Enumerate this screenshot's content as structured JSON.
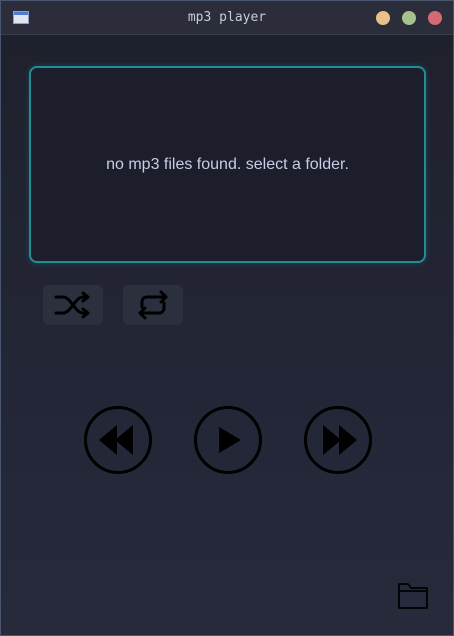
{
  "window": {
    "title": "mp3 player",
    "icon": "app-window-icon",
    "controls": [
      "minimize-button",
      "maximize-button",
      "close-button"
    ],
    "colors": {
      "minimize": "#e7c189",
      "maximize": "#a6c08e",
      "close": "#d46a73"
    }
  },
  "display": {
    "message": "no mp3 files found. select a folder.",
    "accent": "#1f8f95"
  },
  "toggles": [
    {
      "name": "shuffle",
      "icon": "shuffle-icon"
    },
    {
      "name": "repeat",
      "icon": "repeat-icon"
    }
  ],
  "transport": {
    "previous_icon": "rewind-icon",
    "play_icon": "play-icon",
    "next_icon": "fast-forward-icon"
  },
  "folder": {
    "icon": "folder-icon"
  }
}
